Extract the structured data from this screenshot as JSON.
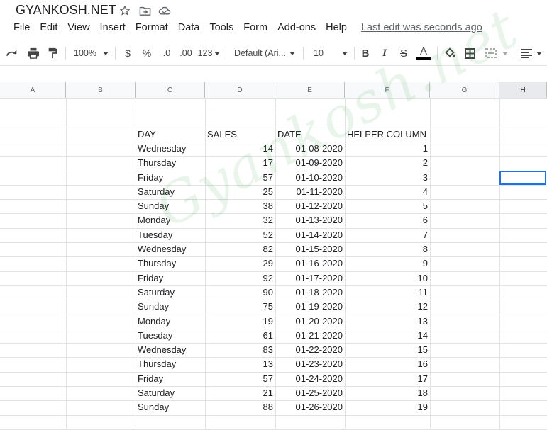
{
  "doc": {
    "title": "GYANKOSH.NET"
  },
  "menu": {
    "items": [
      "File",
      "Edit",
      "View",
      "Insert",
      "Format",
      "Data",
      "Tools",
      "Form",
      "Add-ons",
      "Help"
    ],
    "last_edit": "Last edit was seconds ago"
  },
  "toolbar": {
    "zoom": "100%",
    "currency": "$",
    "percent": "%",
    "dec_decrease": ".0",
    "dec_increase": ".00",
    "more_formats": "123",
    "font": "Default (Ari...",
    "font_size": "10",
    "bold": "B",
    "italic": "I",
    "strike": "S",
    "text_color": "A"
  },
  "columns": [
    "A",
    "B",
    "C",
    "D",
    "E",
    "F",
    "G",
    "H"
  ],
  "sheet": {
    "headers": [
      "DAY",
      "SALES",
      "DATE",
      "HELPER COLUMN"
    ],
    "rows": [
      [
        "Wednesday",
        "14",
        "01-08-2020",
        "1"
      ],
      [
        "Thursday",
        "17",
        "01-09-2020",
        "2"
      ],
      [
        "Friday",
        "57",
        "01-10-2020",
        "3"
      ],
      [
        "Saturday",
        "25",
        "01-11-2020",
        "4"
      ],
      [
        "Sunday",
        "38",
        "01-12-2020",
        "5"
      ],
      [
        "Monday",
        "32",
        "01-13-2020",
        "6"
      ],
      [
        "Tuesday",
        "52",
        "01-14-2020",
        "7"
      ],
      [
        "Wednesday",
        "82",
        "01-15-2020",
        "8"
      ],
      [
        "Thursday",
        "29",
        "01-16-2020",
        "9"
      ],
      [
        "Friday",
        "92",
        "01-17-2020",
        "10"
      ],
      [
        "Saturday",
        "90",
        "01-18-2020",
        "11"
      ],
      [
        "Sunday",
        "75",
        "01-19-2020",
        "12"
      ],
      [
        "Monday",
        "19",
        "01-20-2020",
        "13"
      ],
      [
        "Tuesday",
        "61",
        "01-21-2020",
        "14"
      ],
      [
        "Wednesday",
        "83",
        "01-22-2020",
        "15"
      ],
      [
        "Thursday",
        "13",
        "01-23-2020",
        "16"
      ],
      [
        "Friday",
        "57",
        "01-24-2020",
        "17"
      ],
      [
        "Saturday",
        "21",
        "01-25-2020",
        "18"
      ],
      [
        "Sunday",
        "88",
        "01-26-2020",
        "19"
      ]
    ]
  },
  "watermark": "Gyankosh.net",
  "colors": {
    "accent": "#1a73e8",
    "header_bg": "#f8f9fa",
    "grid": "#e2e3e3"
  }
}
